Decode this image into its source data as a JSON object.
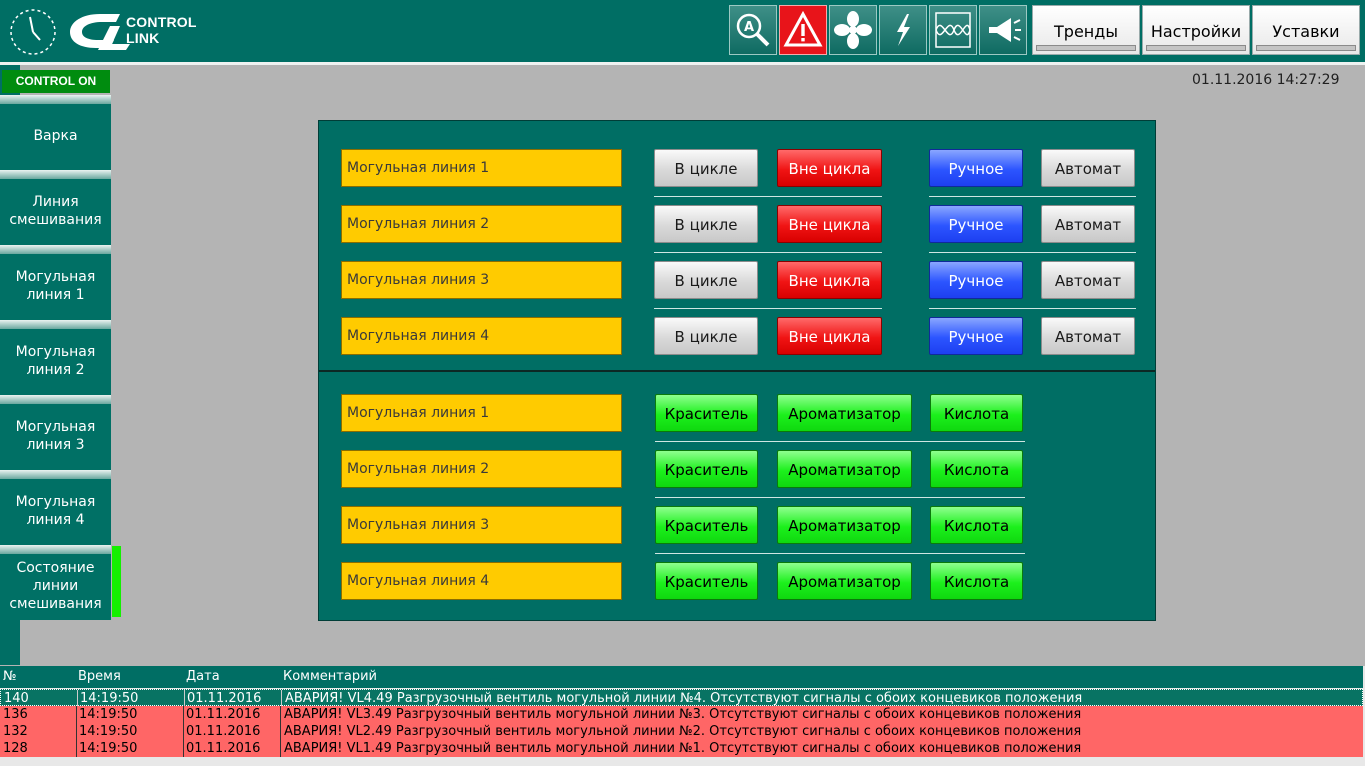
{
  "logo": {
    "line1": "CONTROL",
    "line2": "LINK"
  },
  "header_icons": [
    {
      "icon": "search-alpha-icon"
    },
    {
      "icon": "alarm-warning-icon",
      "color": "#e8141a"
    },
    {
      "icon": "fan-icon"
    },
    {
      "icon": "lightning-icon"
    },
    {
      "icon": "oscillogram-icon"
    },
    {
      "icon": "megaphone-icon"
    }
  ],
  "header_buttons": [
    "Тренды",
    "Настройки",
    "Уставки"
  ],
  "status": {
    "label": "CONTROL ON",
    "color": "#008c0f"
  },
  "datetime": "01.11.2016 14:27:29",
  "nav": [
    "Варка",
    "Линия\nсмешивания",
    "Могульная\nлиния 1",
    "Могульная\nлиния 2",
    "Могульная\nлиния 3",
    "Могульная\nлиния 4",
    "Состояние\nлинии\nсмешивания"
  ],
  "nav_active_index": 6,
  "mode_section": {
    "buttons": {
      "in_cycle": "В цикле",
      "out_cycle": "Вне цикла",
      "manual": "Ручное",
      "auto": "Автомат"
    },
    "lines": [
      "Могульная линия 1",
      "Могульная линия 2",
      "Могульная линия 3",
      "Могульная линия 4"
    ]
  },
  "dosing_section": {
    "buttons": {
      "dye": "Краситель",
      "flavor": "Ароматизатор",
      "acid": "Кислота"
    },
    "lines": [
      "Могульная линия 1",
      "Могульная линия 2",
      "Могульная линия 3",
      "Могульная линия 4"
    ]
  },
  "log": {
    "columns": [
      "№",
      "Время",
      "Дата",
      "Комментарий"
    ],
    "rows": [
      {
        "no": "140",
        "time": "14:19:50",
        "date": "01.11.2016",
        "comment": "АВАРИЯ! VL4.49 Разгрузочный вентиль могульной линии №4. Отсутствуют сигналы с обоих концевиков положения",
        "selected": true
      },
      {
        "no": "136",
        "time": "14:19:50",
        "date": "01.11.2016",
        "comment": "АВАРИЯ! VL3.49 Разгрузочный вентиль могульной линии №3. Отсутствуют сигналы с обоих концевиков положения",
        "selected": false
      },
      {
        "no": "132",
        "time": "14:19:50",
        "date": "01.11.2016",
        "comment": "АВАРИЯ! VL2.49 Разгрузочный вентиль могульной линии №2. Отсутствуют сигналы с обоих концевиков положения",
        "selected": false
      },
      {
        "no": "128",
        "time": "14:19:50",
        "date": "01.11.2016",
        "comment": "АВАРИЯ! VL1.49 Разгрузочный вентиль могульной линии №1. Отсутствуют сигналы с обоих концевиков положения",
        "selected": false
      }
    ]
  },
  "colors": {
    "teal": "#006e64",
    "label_yellow": "#ffcb00",
    "alarm_row": "#ff6666",
    "active_marker": "#14f000"
  }
}
